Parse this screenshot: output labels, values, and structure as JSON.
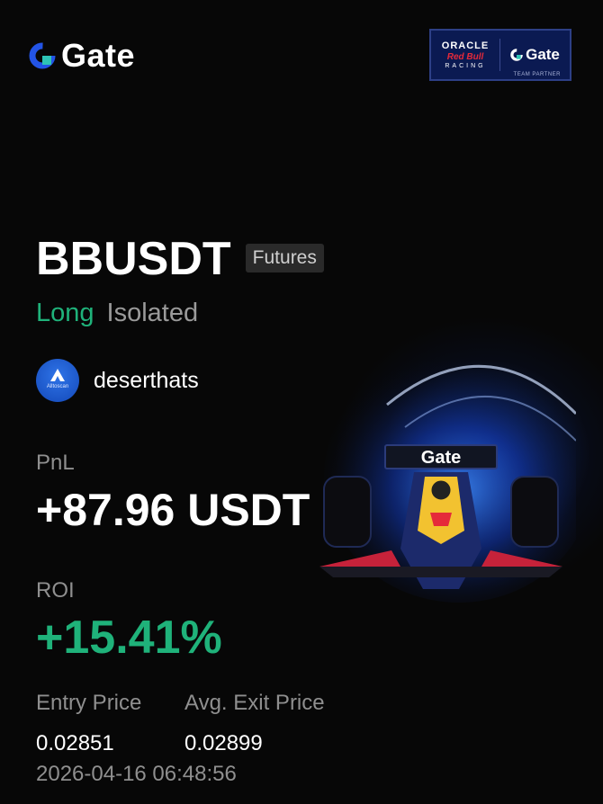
{
  "header": {
    "brand_name": "Gate",
    "brand_icon": "gate-logo-icon",
    "partner": {
      "line1": "ORACLE",
      "line2": "Red Bull",
      "line3": "RACING",
      "brand": "Gate",
      "subtitle": "TEAM PARTNER"
    }
  },
  "position": {
    "symbol": "BBUSDT",
    "market_type": "Futures",
    "side": "Long",
    "margin_mode": "Isolated"
  },
  "user": {
    "avatar_icon": "alltoscan-avatar-icon",
    "avatar_text": "Alltoscan",
    "username": "deserthats"
  },
  "pnl": {
    "label": "PnL",
    "value": "+87.96 USDT"
  },
  "roi": {
    "label": "ROI",
    "value": "+15.41%"
  },
  "prices": {
    "entry_label": "Entry Price",
    "exit_label": "Avg. Exit Price",
    "entry_value": "0.02851",
    "exit_value": "0.02899"
  },
  "timestamp": "2026-04-16 06:48:56",
  "colors": {
    "background": "#070707",
    "positive": "#1fb27a",
    "muted": "#8f8f8f",
    "brand_blue": "#2354e6"
  }
}
